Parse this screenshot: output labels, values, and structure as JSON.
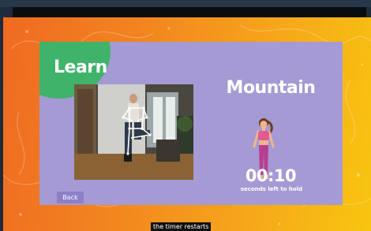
{
  "panel": {
    "badge_label": "Learn",
    "pose_name": "Mountain",
    "timer_value": "00:10",
    "timer_caption": "seconds left to hold",
    "back_label": "Back"
  },
  "caption": "the timer restarts",
  "colors": {
    "panel_bg": "#a59ad3",
    "badge_green": "#3fb36a",
    "gradient_orange": "#ef6a22",
    "gradient_yellow": "#f8c50f",
    "back_button": "#8b80c8"
  },
  "icons": {
    "pose_figure": "woman-mountain-pose-illustration",
    "camera_overlay": "skeleton-pose-overlay"
  }
}
